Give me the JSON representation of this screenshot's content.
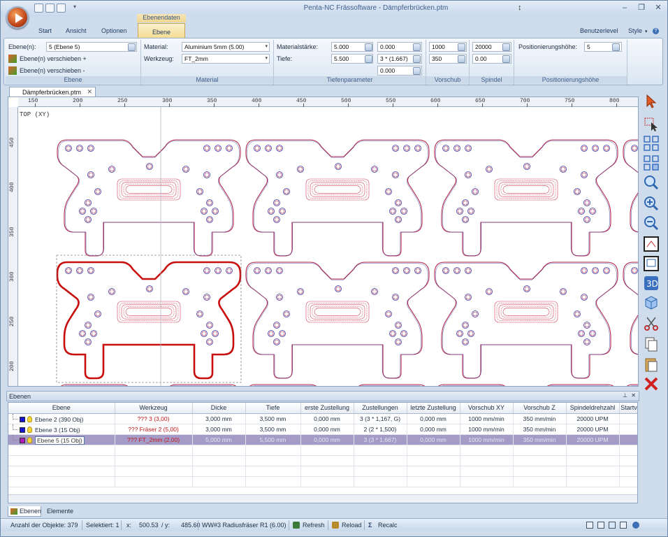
{
  "window": {
    "title": "Penta-NC Frässoftware - Dämpferbrücken.ptm",
    "context_tab_title": "Ebenendaten",
    "controls": [
      "–",
      "❐",
      "✕"
    ]
  },
  "ribbon_tabs": [
    "Start",
    "Ansicht",
    "Optionen",
    "Ebene"
  ],
  "ribbon_right": {
    "level": "Benutzerlevel",
    "style": "Style"
  },
  "ribbon": {
    "ebene": {
      "caption": "Ebene",
      "label": "Ebene(n):",
      "value": "5 (Ebene 5)",
      "move_up": "Ebene(n) verschieben +",
      "move_down": "Ebene(n) verschieben -"
    },
    "material": {
      "caption": "Material",
      "material_label": "Material:",
      "material_value": "Aluminium 5mm (5.00)",
      "tool_label": "Werkzeug:",
      "tool_value": "FT_2mm"
    },
    "tiefen": {
      "caption": "Tiefenparameter",
      "staerke_label": "Materialstärke:",
      "staerke_value": "5.000",
      "tiefe_label": "Tiefe:",
      "tiefe_value": "5.500",
      "val_a": "0.000",
      "val_b": "3 * (1.667)",
      "val_c": "0.000"
    },
    "vorschub": {
      "caption": "Vorschub",
      "v1": "1000",
      "v2": "350"
    },
    "spindel": {
      "caption": "Spindel",
      "v1": "20000",
      "v2": "0.00"
    },
    "position": {
      "caption": "Positionierungshöhe",
      "label": "Positionierungshöhe:",
      "value": "5"
    }
  },
  "document_tab": "Dämpferbrücken.ptm",
  "view_label": "TOP (XY)",
  "ruler_h": [
    "150",
    "200",
    "250",
    "300",
    "350",
    "400",
    "450",
    "500",
    "550",
    "600",
    "650",
    "700",
    "750",
    "800"
  ],
  "ruler_v": [
    "450",
    "400",
    "350",
    "300",
    "250",
    "200"
  ],
  "layers_panel": {
    "title": "Ebenen",
    "columns": [
      "Ebene",
      "Werkzeug",
      "Dicke",
      "Tiefe",
      "erste Zustellung",
      "Zustellungen",
      "letzte Zustellung",
      "Vorschub XY",
      "Vorschub Z",
      "Spindeldrehzahl",
      "Startv"
    ],
    "rows": [
      {
        "name": "Ebene 2 (390 Obj)",
        "color": "#1414d2",
        "tool": "??? 3 (3,00)",
        "dicke": "3,000 mm",
        "tiefe": "3,500 mm",
        "erste": "0,000 mm",
        "zust": "3 (3 * 1,167, G)",
        "letzte": "0,000 mm",
        "vxy": "1000 mm/min",
        "vz": "350 mm/min",
        "spindel": "20000 UPM"
      },
      {
        "name": "Ebene 3 (15 Obj)",
        "color": "#1414d2",
        "tool": "??? Fräser 2 (5,00)",
        "dicke": "3,000 mm",
        "tiefe": "3,500 mm",
        "erste": "0,000 mm",
        "zust": "2 (2 * 1,500)",
        "letzte": "0,000 mm",
        "vxy": "1000 mm/min",
        "vz": "350 mm/min",
        "spindel": "20000 UPM"
      },
      {
        "name": "Ebene 5 (15 Obj)",
        "color": "#b01ab8",
        "tool": "??? FT_2mm (2,00)",
        "dicke": "5,000 mm",
        "tiefe": "5,500 mm",
        "erste": "0,000 mm",
        "zust": "3 (3 * 1,667)",
        "letzte": "0,000 mm",
        "vxy": "1000 mm/min",
        "vz": "350 mm/min",
        "spindel": "20000 UPM"
      }
    ]
  },
  "bottom_tabs": [
    "Ebenen",
    "Elemente"
  ],
  "status": {
    "count": "Anzahl der Objekte: 379",
    "selected": "Selektiert: 1",
    "x_label": "x:",
    "x": "500.53",
    "y_label": "/ y:",
    "y": "485.60",
    "tool": "WW#3 Radiusfräser R1 (6.00)",
    "refresh": "Refresh",
    "reload": "Reload",
    "recalc": "Recalc"
  },
  "colors": {
    "part_outline": "#b4294a",
    "selected_part": "#c80e0e",
    "hole": "#3a3aa8",
    "pocket": "#cf3f5a"
  }
}
